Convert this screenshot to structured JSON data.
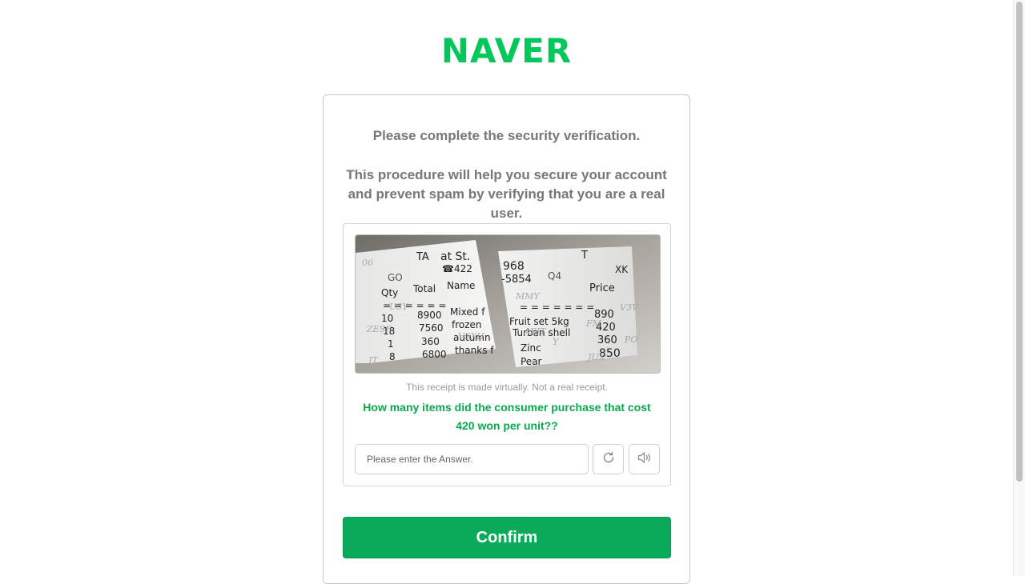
{
  "logo": {
    "text": "NAVER",
    "color": "#03c75a"
  },
  "intro": {
    "line1": "Please complete the security verification.",
    "line2": "This procedure will help you secure your account and prevent spam by verifying that you are a real user."
  },
  "captcha": {
    "receipt_left": {
      "header": [
        "TA",
        "at St.",
        "☎422",
        "GO"
      ],
      "columns": [
        "Qty",
        "Total",
        "Name"
      ],
      "rows": [
        [
          "10",
          "8900",
          "Mixed f"
        ],
        [
          "18",
          "7560",
          "frozen"
        ],
        [
          "1",
          "360",
          "autumn"
        ],
        [
          "8",
          "6800",
          "thanks f"
        ]
      ]
    },
    "receipt_right": {
      "header": [
        "968",
        "-5854",
        "Q4",
        "T",
        "XK"
      ],
      "column": "Price",
      "rows": [
        [
          "Fruit set 5kg",
          "890"
        ],
        [
          "Turban shell",
          "420"
        ],
        [
          "Zinc",
          "360"
        ],
        [
          "Pear",
          "850"
        ]
      ]
    },
    "notice": "This receipt is made virtually. Not a real receipt.",
    "question": "How many items did the consumer purchase that cost 420 won per unit??",
    "answer_placeholder": "Please enter the Answer.",
    "refresh_icon": "refresh-icon",
    "audio_icon": "speaker-icon",
    "accent_color": "#0aa84f"
  },
  "confirm": {
    "label": "Confirm",
    "color": "#0aaa5b"
  }
}
